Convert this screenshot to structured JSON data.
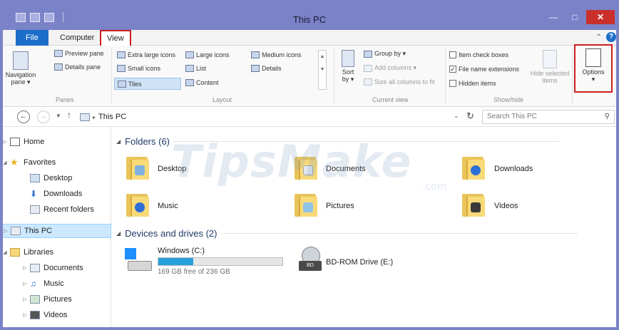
{
  "window": {
    "title": "This PC"
  },
  "tabs": {
    "file": "File",
    "computer": "Computer",
    "view": "View"
  },
  "ribbon": {
    "panes": {
      "label": "Panes",
      "navigation_pane_line1": "Navigation",
      "navigation_pane_line2": "pane ▾",
      "preview_pane": "Preview pane",
      "details_pane": "Details pane"
    },
    "layout": {
      "label": "Layout",
      "items": [
        "Extra large icons",
        "Large icons",
        "Medium icons",
        "Small icons",
        "List",
        "Details",
        "Tiles",
        "Content"
      ],
      "selected": "Tiles"
    },
    "current_view": {
      "label": "Current view",
      "sort_line1": "Sort",
      "sort_line2": "by ▾",
      "group_by": "Group by ▾",
      "add_columns": "Add columns ▾",
      "size_all_columns": "Size all columns to fit"
    },
    "show_hide": {
      "label": "Show/hide",
      "item_check_boxes": "Item check boxes",
      "file_name_extensions": "File name extensions",
      "hidden_items": "Hidden items",
      "hide_selected_line1": "Hide selected",
      "hide_selected_line2": "items"
    },
    "options": {
      "label": "Options",
      "arrow": "▾"
    }
  },
  "address": {
    "path": "This PC",
    "search_placeholder": "Search This PC"
  },
  "nav_pane": {
    "home": "Home",
    "favorites": "Favorites",
    "desktop": "Desktop",
    "downloads": "Downloads",
    "recent_folders": "Recent folders",
    "this_pc": "This PC",
    "libraries": "Libraries",
    "lib_documents": "Documents",
    "lib_music": "Music",
    "lib_pictures": "Pictures",
    "lib_videos": "Videos"
  },
  "content": {
    "folders_header": "Folders (6)",
    "folders": [
      "Desktop",
      "Documents",
      "Downloads",
      "Music",
      "Pictures",
      "Videos"
    ],
    "devices_header": "Devices and drives (2)",
    "drive_c": {
      "name": "Windows (C:)",
      "free_text": "169 GB free of 236 GB",
      "used_fraction": 0.284
    },
    "drive_e": {
      "name": "BD-ROM Drive (E:)"
    }
  },
  "watermark": {
    "main": "TipsMake",
    "suffix": ".com"
  }
}
